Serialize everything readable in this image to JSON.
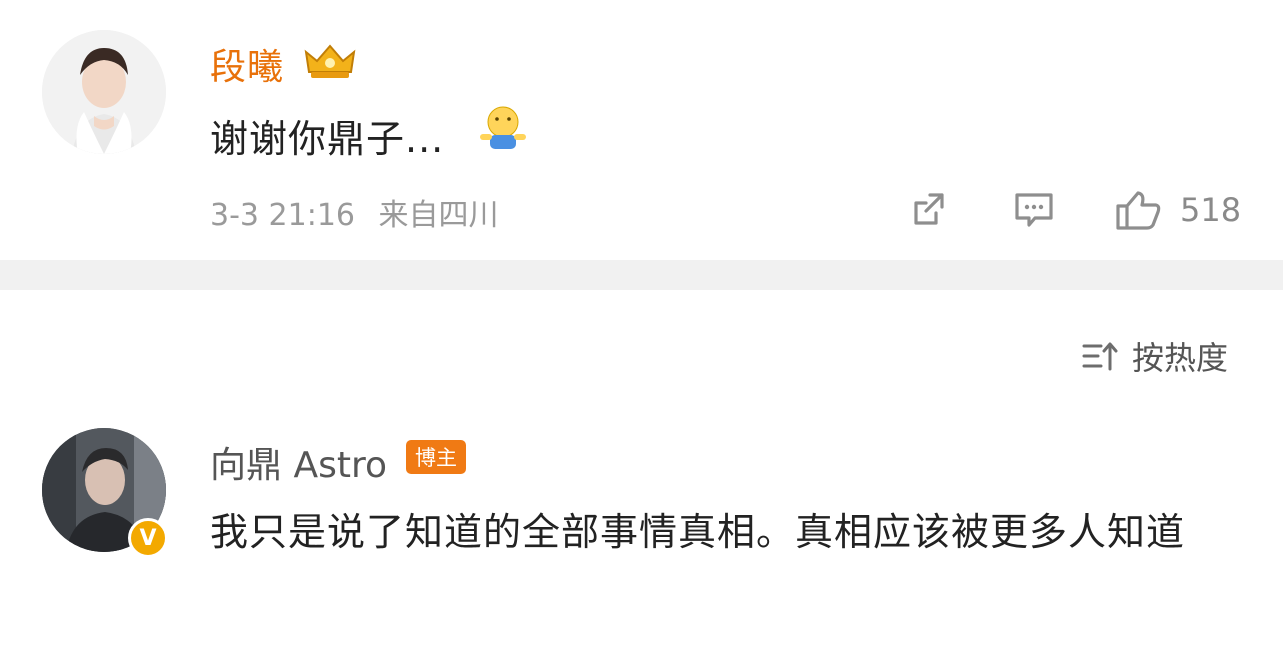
{
  "comment_top": {
    "username": "段曦",
    "text": "谢谢你鼎子...",
    "time": "3-3 21:16",
    "source": "来自四川",
    "like_count": "518",
    "name_color": "#e8710a"
  },
  "sort": {
    "label": "按热度"
  },
  "comment_main": {
    "username": "向鼎 Astro",
    "badge": "博主",
    "verify_symbol": "V",
    "text": "我只是说了知道的全部事情真相。真相应该被更多人知道",
    "badge_color": "#f07a14"
  },
  "icons": [
    "crown-icon",
    "emoji-icon",
    "share-icon",
    "comment-icon",
    "like-icon",
    "sort-icon",
    "verified-icon"
  ]
}
